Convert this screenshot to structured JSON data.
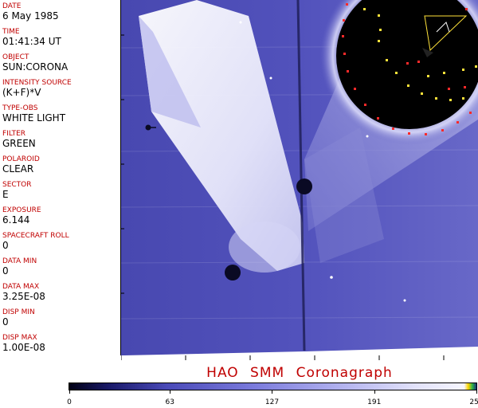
{
  "metadata": [
    {
      "label": "DATE",
      "value": "6 May 1985"
    },
    {
      "label": "TIME",
      "value": "01:41:34 UT"
    },
    {
      "label": "OBJECT",
      "value": "SUN:CORONA"
    },
    {
      "label": "INTENSITY SOURCE",
      "value": "(K+F)*V"
    },
    {
      "label": "TYPE-OBS",
      "value": "WHITE LIGHT"
    },
    {
      "label": "FILTER",
      "value": "GREEN"
    },
    {
      "label": "POLAROID",
      "value": "CLEAR"
    },
    {
      "label": "SECTOR",
      "value": "E"
    },
    {
      "label": "EXPOSURE",
      "value": "6.144"
    },
    {
      "label": "SPACECRAFT ROLL",
      "value": "0"
    },
    {
      "label": "DATA MIN",
      "value": "0"
    },
    {
      "label": "DATA MAX",
      "value": "3.25E-08"
    },
    {
      "label": "DISP MIN",
      "value": "0"
    },
    {
      "label": "DISP MAX",
      "value": "1.00E-08"
    }
  ],
  "caption": "HAO  SMM Coronagraph",
  "colorbar": {
    "ticks": [
      "0",
      "63",
      "127",
      "191",
      "255"
    ],
    "range": [
      0,
      255
    ]
  },
  "colors": {
    "label": "#c00000",
    "image_base": "#4b4bb5",
    "occulter": "#000000"
  }
}
